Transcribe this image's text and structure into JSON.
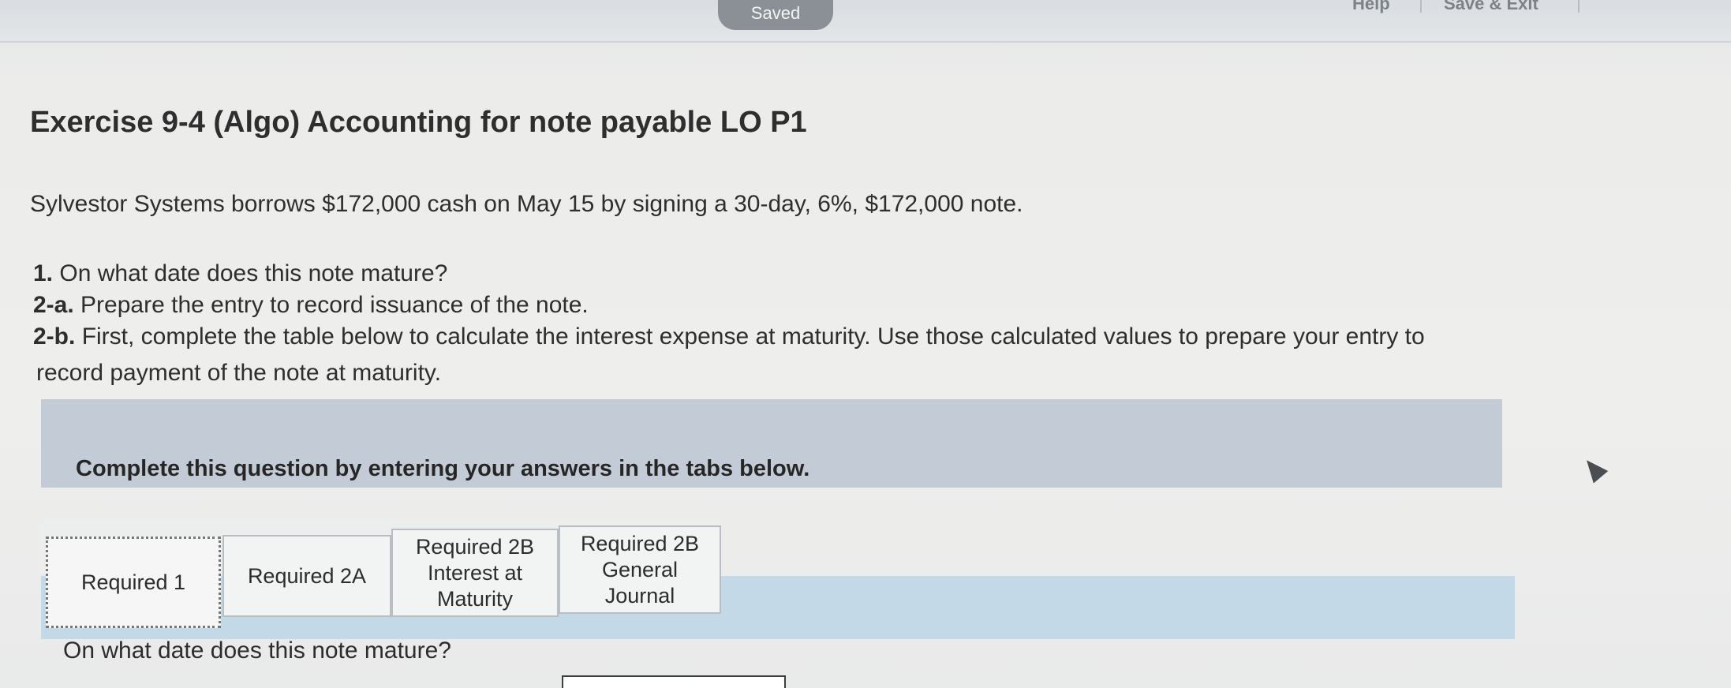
{
  "topbar": {
    "saved_label": "Saved",
    "help_label": "Help",
    "save_exit_label": "Save & Exit"
  },
  "question": {
    "title": "Exercise 9-4 (Algo) Accounting for note payable LO P1",
    "intro": "Sylvestor Systems borrows $172,000 cash on May 15 by signing a 30-day, 6%, $172,000 note.",
    "requirements": [
      {
        "num": "1.",
        "text": "On what date does this note mature?"
      },
      {
        "num": "2-a.",
        "text": "Prepare the entry to record issuance of the note."
      },
      {
        "num": "2-b.",
        "text": "First, complete the table below to calculate the interest expense at maturity. Use those calculated values to prepare your entry to"
      },
      {
        "num": "",
        "text": "record payment of the note at maturity."
      }
    ]
  },
  "banner": {
    "text": "Complete this question by entering your answers in the tabs below."
  },
  "tabs": [
    {
      "line1": "Required 1",
      "line2": "",
      "line3": "",
      "active": true
    },
    {
      "line1": "Required 2A",
      "line2": "",
      "line3": "",
      "active": false
    },
    {
      "line1": "Required 2B",
      "line2": "Interest at",
      "line3": "Maturity",
      "active": false
    },
    {
      "line1": "Required 2B",
      "line2": "General",
      "line3": "Journal",
      "active": false
    }
  ],
  "panel": {
    "question": "On what date does this note mature?",
    "answer_value": ""
  },
  "colors": {
    "banner_bg": "#c3cbd7",
    "tab_strip_bg": "#c3d9e7",
    "saved_pill_bg": "#8a9096"
  }
}
